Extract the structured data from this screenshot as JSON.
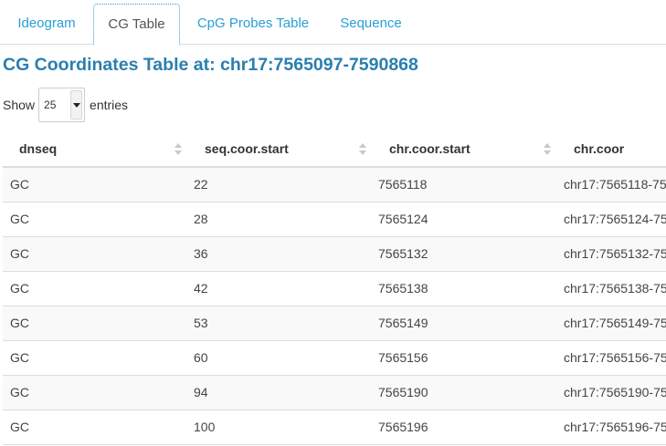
{
  "tabs": [
    {
      "label": "Ideogram",
      "active": false
    },
    {
      "label": "CG Table",
      "active": true
    },
    {
      "label": "CpG Probes Table",
      "active": false
    },
    {
      "label": "Sequence",
      "active": false
    }
  ],
  "page_title": "CG Coordinates Table at: chr17:7565097-7590868",
  "length_control": {
    "prefix": "Show",
    "selected": "25",
    "suffix": "entries"
  },
  "table": {
    "columns": [
      "dnseq",
      "seq.coor.start",
      "chr.coor.start",
      "chr.coor"
    ],
    "rows": [
      [
        "GC",
        "22",
        "7565118",
        "chr17:7565118-75"
      ],
      [
        "GC",
        "28",
        "7565124",
        "chr17:7565124-75"
      ],
      [
        "GC",
        "36",
        "7565132",
        "chr17:7565132-75"
      ],
      [
        "GC",
        "42",
        "7565138",
        "chr17:7565138-75"
      ],
      [
        "GC",
        "53",
        "7565149",
        "chr17:7565149-75"
      ],
      [
        "GC",
        "60",
        "7565156",
        "chr17:7565156-75"
      ],
      [
        "GC",
        "94",
        "7565190",
        "chr17:7565190-75"
      ],
      [
        "GC",
        "100",
        "7565196",
        "chr17:7565196-75"
      ]
    ]
  },
  "colors": {
    "accent": "#2a9fd6",
    "title": "#2a7fb0",
    "stripe": "#f9f9f9",
    "border": "#dddddd"
  },
  "icons": {
    "sort": "sort-both-icon",
    "dropdown": "caret-down-icon"
  }
}
